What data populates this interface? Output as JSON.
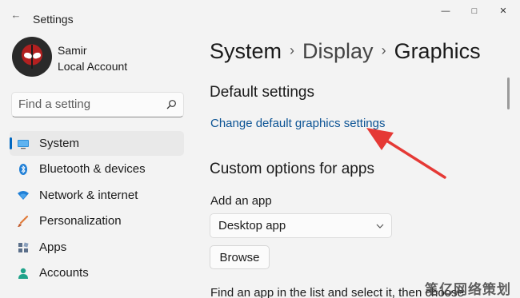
{
  "window": {
    "title": "Settings",
    "back_icon": "back-arrow-icon",
    "controls": {
      "minimize": "—",
      "maximize": "□",
      "close": "✕"
    }
  },
  "user": {
    "name": "Samir",
    "account_type": "Local Account"
  },
  "search": {
    "placeholder": "Find a setting",
    "value": ""
  },
  "sidebar": {
    "items": [
      {
        "label": "System",
        "icon": "monitor-icon",
        "active": true
      },
      {
        "label": "Bluetooth & devices",
        "icon": "bluetooth-icon",
        "active": false
      },
      {
        "label": "Network & internet",
        "icon": "wifi-icon",
        "active": false
      },
      {
        "label": "Personalization",
        "icon": "brush-icon",
        "active": false
      },
      {
        "label": "Apps",
        "icon": "apps-icon",
        "active": false
      },
      {
        "label": "Accounts",
        "icon": "person-icon",
        "active": false
      }
    ]
  },
  "breadcrumb": {
    "items": [
      "System",
      "Display",
      "Graphics"
    ],
    "separator": "›"
  },
  "main": {
    "default_section_title": "Default settings",
    "default_link": "Change default graphics settings",
    "custom_section_title": "Custom options for apps",
    "add_app_label": "Add an app",
    "app_type_selected": "Desktop app",
    "browse_label": "Browse",
    "helper_text": "Find an app in the list and select it, then choose"
  },
  "annotation": {
    "type": "arrow",
    "color": "#e53935"
  },
  "watermark": "笔亿网络策划",
  "colors": {
    "accent": "#0067c0",
    "link": "#0b5394",
    "background": "#f3f3f3"
  }
}
